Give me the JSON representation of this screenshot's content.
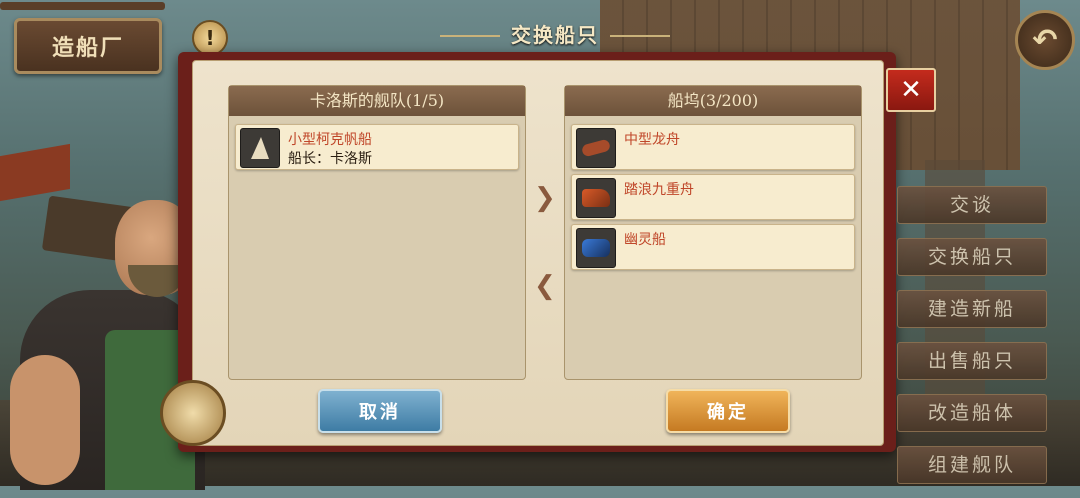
{
  "header": {
    "shipyard_sign": "造船厂",
    "alert_icon": "exclamation-icon",
    "back_icon": "back-arrow-icon",
    "title": "交换船只",
    "close_icon": "close-icon"
  },
  "fleet_panel": {
    "title": "卡洛斯的舰队(1/5)",
    "ships": [
      {
        "name": "小型柯克帆船",
        "captain": "船长：卡洛斯",
        "thumb": "sail-ship-icon"
      }
    ]
  },
  "dock_panel": {
    "title": "船坞(3/200)",
    "ships": [
      {
        "name": "中型龙舟",
        "thumb": "dragon-boat-icon"
      },
      {
        "name": "踏浪九重舟",
        "thumb": "red-ship-icon"
      },
      {
        "name": "幽灵船",
        "thumb": "ghost-ship-icon"
      }
    ]
  },
  "transfer": {
    "to_dock_icon": "arrow-right-icon",
    "to_fleet_icon": "arrow-left-icon"
  },
  "buttons": {
    "cancel": "取消",
    "confirm": "确定"
  },
  "side_menu": [
    "交谈",
    "交换船只",
    "建造新船",
    "出售船只",
    "改造船体",
    "组建舰队"
  ]
}
